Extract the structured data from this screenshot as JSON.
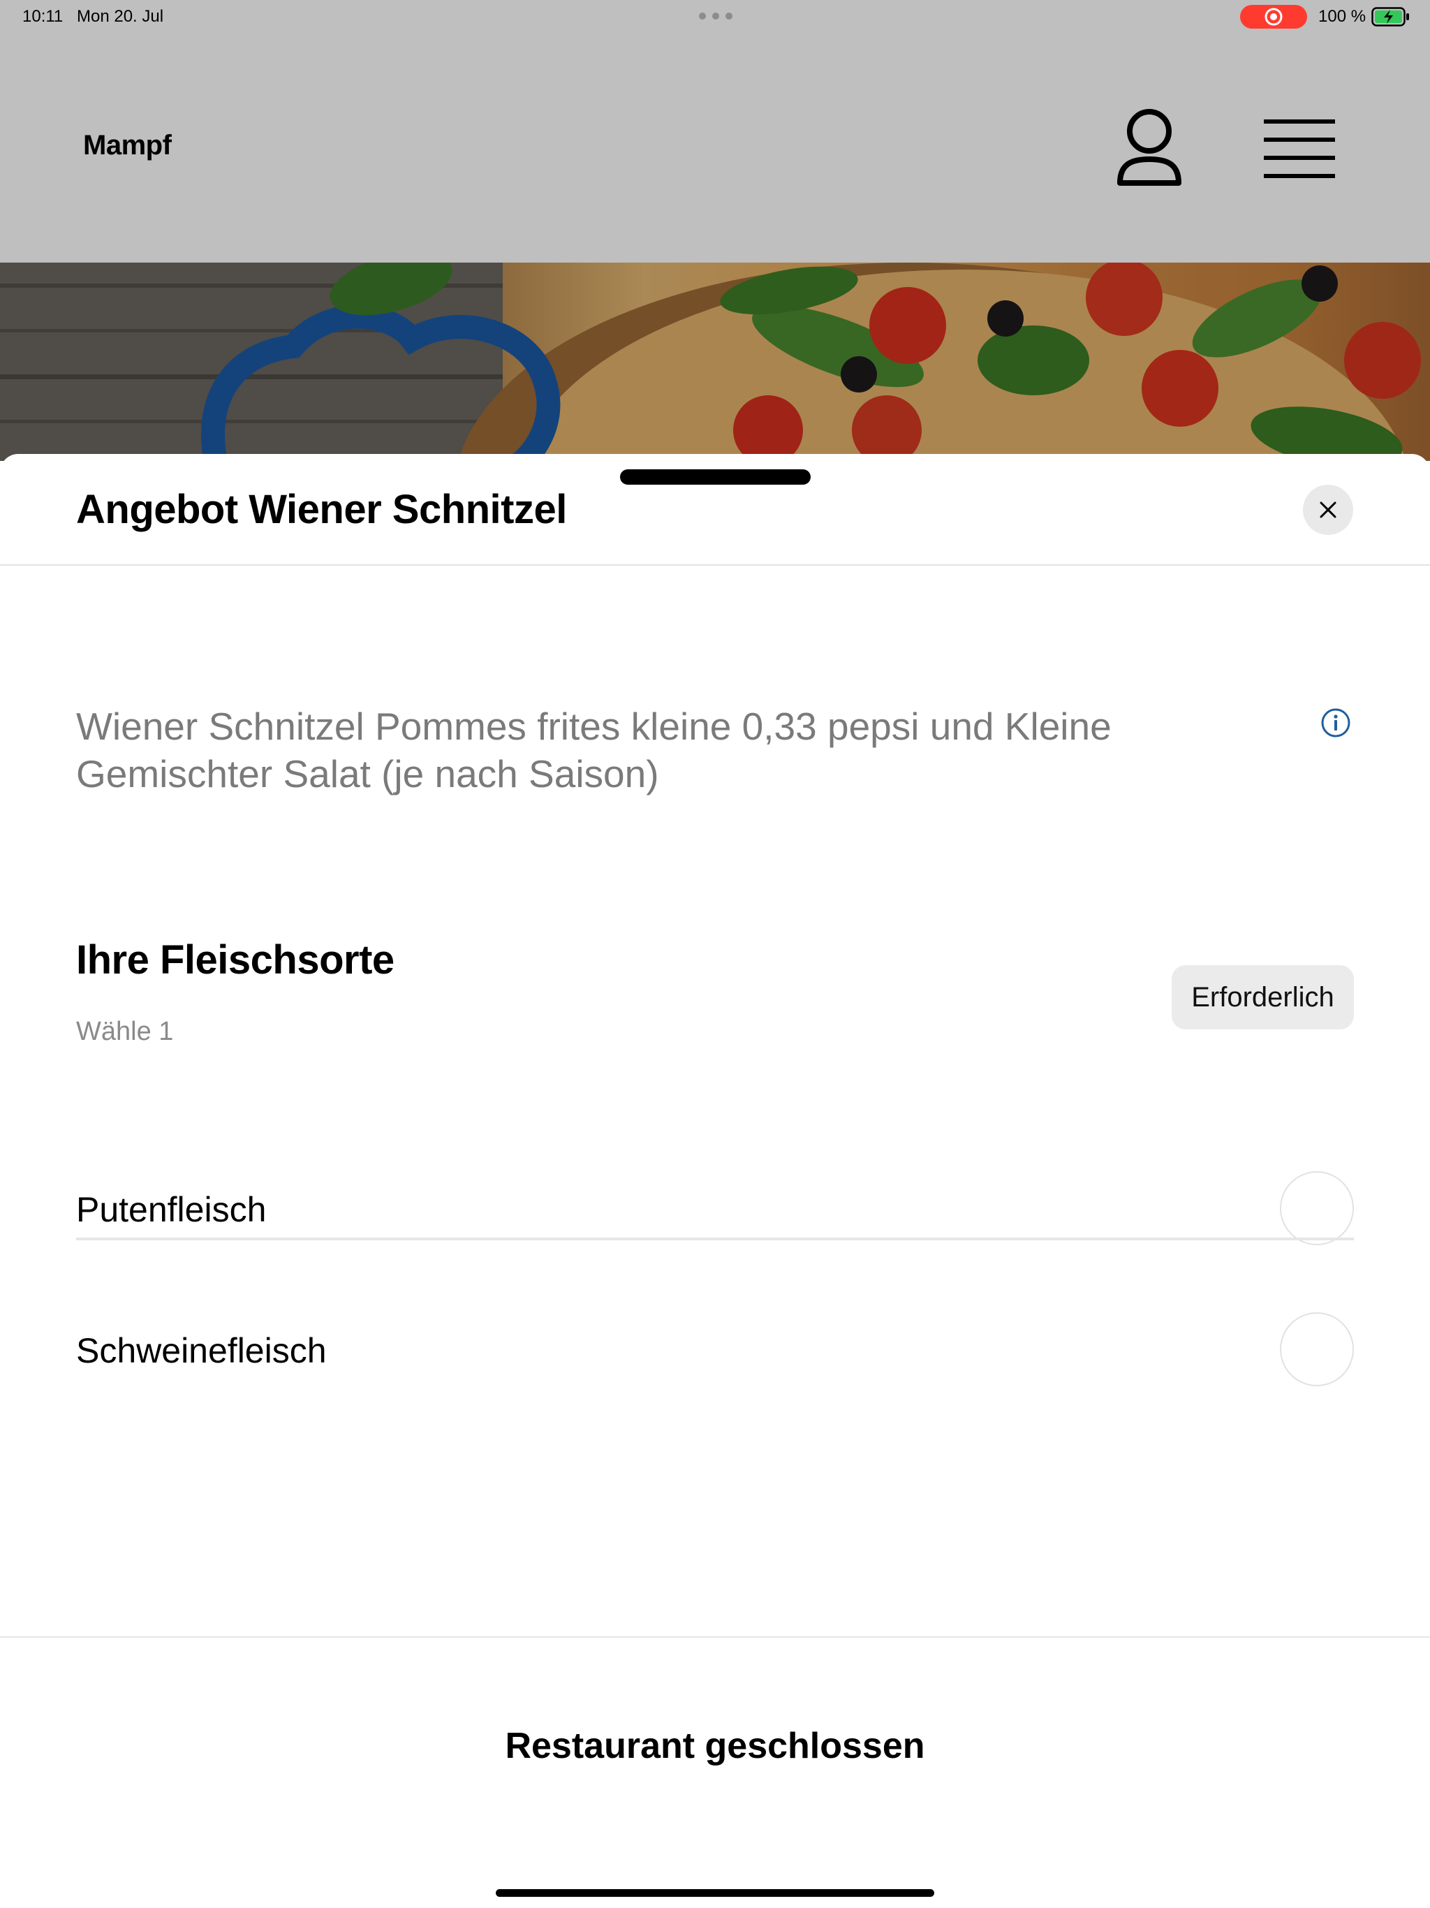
{
  "status_bar": {
    "time": "10:11",
    "date": "Mon 20. Jul",
    "battery": "100 %",
    "record_color": "#ff3b30"
  },
  "app": {
    "brand": "Mampf",
    "profile_icon": "person-icon",
    "menu_icon": "hamburger-menu-icon"
  },
  "sheet": {
    "title": "Angebot Wiener Schnitzel",
    "close_icon": "close-icon",
    "description": "Wiener Schnitzel Pommes frites kleine 0,33 pepsi und Kleine Gemischter Salat (je nach Saison)",
    "info_icon": "info-icon",
    "section": {
      "title": "Ihre Fleischsorte",
      "subtitle": "Wähle 1",
      "badge": "Erforderlich",
      "options": [
        {
          "label": "Putenfleisch",
          "selected": false
        },
        {
          "label": "Schweinefleisch",
          "selected": false
        }
      ]
    },
    "footer_status": "Restaurant geschlossen"
  },
  "colors": {
    "info_icon": "#1f5f9e",
    "badge_bg": "#ebebeb",
    "description_text": "#7a7a7a"
  }
}
